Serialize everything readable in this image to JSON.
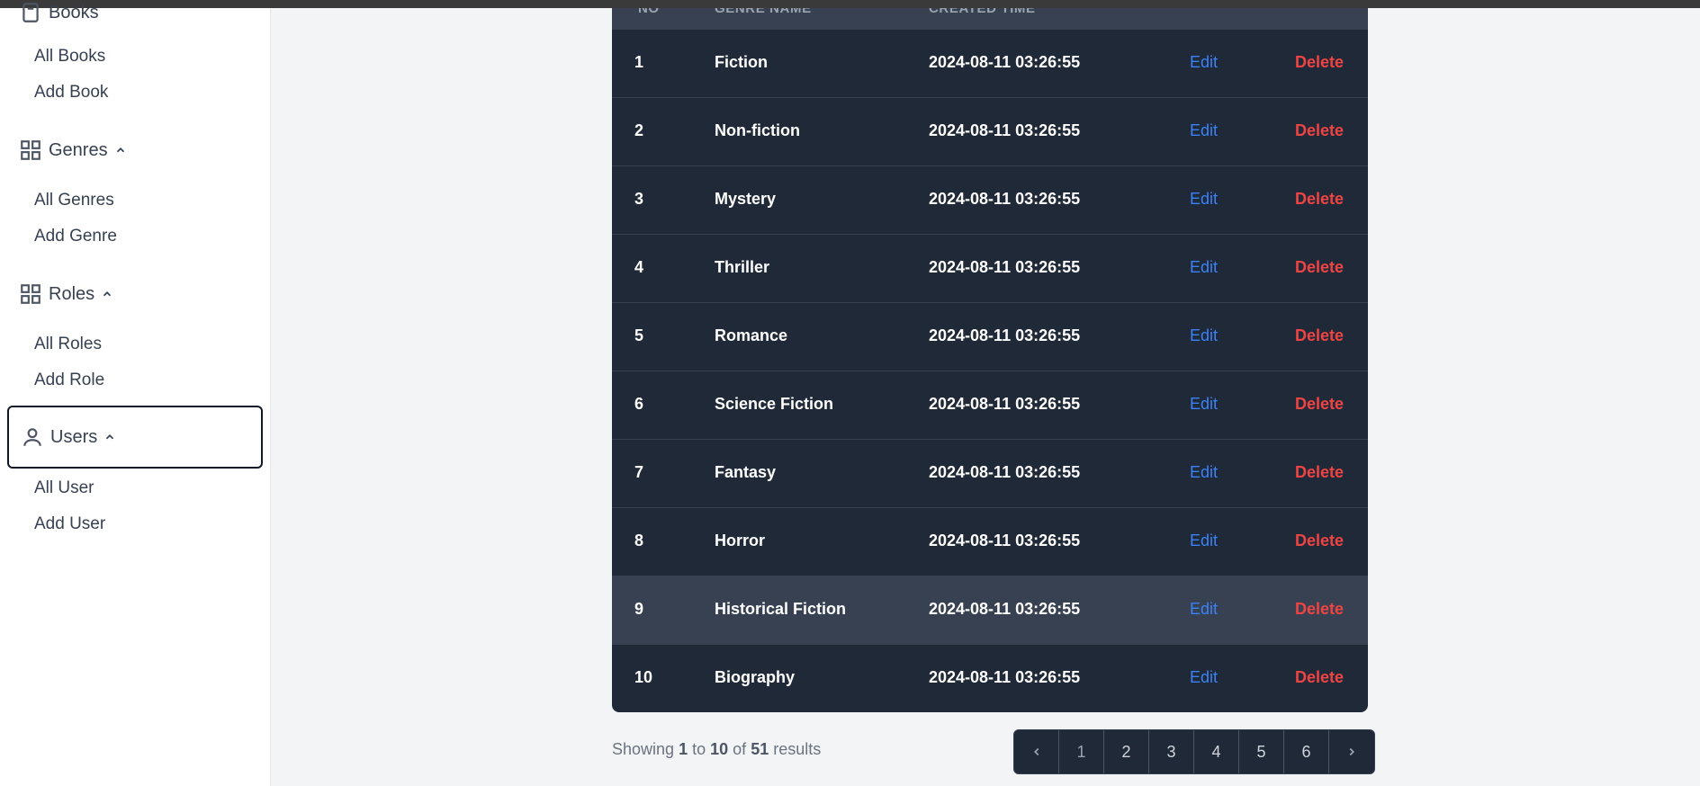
{
  "sidebar": {
    "books": {
      "label": "Books",
      "items": [
        "All Books",
        "Add Book"
      ]
    },
    "genres": {
      "label": "Genres",
      "items": [
        "All Genres",
        "Add Genre"
      ]
    },
    "roles": {
      "label": "Roles",
      "items": [
        "All Roles",
        "Add Role"
      ]
    },
    "users": {
      "label": "Users",
      "items": [
        "All User",
        "Add User"
      ]
    }
  },
  "table": {
    "headers": [
      "NO",
      "GENRE NAME",
      "CREATED TIME"
    ],
    "edit_label": "Edit",
    "delete_label": "Delete",
    "rows": [
      {
        "no": "1",
        "name": "Fiction",
        "created": "2024-08-11 03:26:55"
      },
      {
        "no": "2",
        "name": "Non-fiction",
        "created": "2024-08-11 03:26:55"
      },
      {
        "no": "3",
        "name": "Mystery",
        "created": "2024-08-11 03:26:55"
      },
      {
        "no": "4",
        "name": "Thriller",
        "created": "2024-08-11 03:26:55"
      },
      {
        "no": "5",
        "name": "Romance",
        "created": "2024-08-11 03:26:55"
      },
      {
        "no": "6",
        "name": "Science Fiction",
        "created": "2024-08-11 03:26:55"
      },
      {
        "no": "7",
        "name": "Fantasy",
        "created": "2024-08-11 03:26:55"
      },
      {
        "no": "8",
        "name": "Horror",
        "created": "2024-08-11 03:26:55"
      },
      {
        "no": "9",
        "name": "Historical Fiction",
        "created": "2024-08-11 03:26:55"
      },
      {
        "no": "10",
        "name": "Biography",
        "created": "2024-08-11 03:26:55"
      }
    ]
  },
  "footer": {
    "showing_prefix": "Showing",
    "from": "1",
    "to_word": "to",
    "to": "10",
    "of_word": "of",
    "total": "51",
    "results_word": "results"
  },
  "pagination": {
    "pages": [
      "1",
      "2",
      "3",
      "4",
      "5",
      "6"
    ],
    "current": "1"
  },
  "colors": {
    "edit": "#3b82f6",
    "delete": "#ef4444",
    "table_bg": "#1f2937",
    "row_hover": "#374151"
  }
}
